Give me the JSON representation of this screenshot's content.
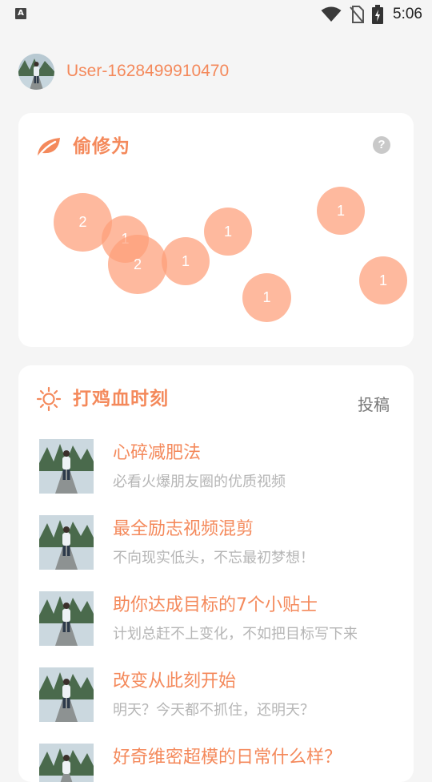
{
  "status_bar": {
    "time": "5:06",
    "app_badge": "A"
  },
  "user": {
    "name": "User-1628499910470"
  },
  "card1": {
    "title": "偷修为",
    "help": "?",
    "bubbles": [
      "2",
      "1",
      "2",
      "1",
      "1",
      "1",
      "1",
      "1"
    ]
  },
  "card2": {
    "title": "打鸡血时刻",
    "submit_label": "投稿",
    "articles": [
      {
        "title": "心碎减肥法",
        "subtitle": "必看火爆朋友圈的优质视频"
      },
      {
        "title": "最全励志视频混剪",
        "subtitle": "不向现实低头，不忘最初梦想！"
      },
      {
        "title": "助你达成目标的7个小贴士",
        "subtitle": "计划总赶不上变化，不如把目标写下来"
      },
      {
        "title": "改变从此刻开始",
        "subtitle": "明天？今天都不抓住，还明天？"
      },
      {
        "title": "好奇维密超模的日常什么样？",
        "subtitle": ""
      }
    ]
  },
  "colors": {
    "accent": "#f4895b",
    "bubble": "#fd9e79",
    "background": "#f5f5f5"
  }
}
